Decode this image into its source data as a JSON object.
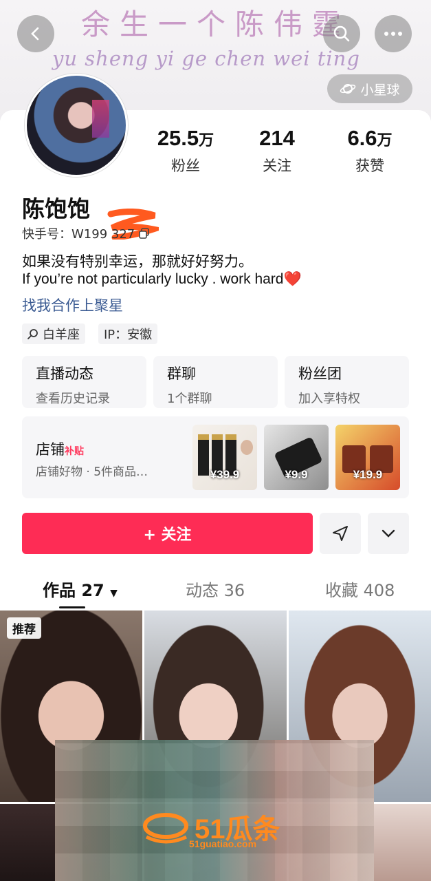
{
  "banner": {
    "title": "余生一个陈伟霆",
    "subtitle": "yu sheng yi ge chen wei ting"
  },
  "header": {
    "back_icon": "chevron-left-icon",
    "search_icon": "search-icon",
    "more_icon": "more-icon",
    "planet_label": "小星球"
  },
  "profile": {
    "stats": [
      {
        "value": "25.5",
        "unit": "万",
        "label": "粉丝"
      },
      {
        "value": "214",
        "unit": "",
        "label": "关注"
      },
      {
        "value": "6.6",
        "unit": "万",
        "label": "获赞"
      }
    ],
    "name": "陈饱饱",
    "kuaishou_id": "快手号：W199  327",
    "bio_line1": "如果没有特别幸运，那就好好努力。",
    "bio_line2": "If you’re not particularly lucky . work hard",
    "bio_emoji": "❤️",
    "cooperate_link": "找我合作上聚星",
    "tags": [
      "白羊座",
      "IP：安徽"
    ]
  },
  "features": [
    {
      "title": "直播动态",
      "subtitle": "查看历史记录"
    },
    {
      "title": "群聊",
      "subtitle": "1个群聊"
    },
    {
      "title": "粉丝团",
      "subtitle": "加入享特权"
    }
  ],
  "shop": {
    "title": "店铺",
    "badge": "补贴",
    "subtitle": "店铺好物 · 5件商品…",
    "items": [
      {
        "price": "¥39.9"
      },
      {
        "price": "¥9.9"
      },
      {
        "price": "¥19.9"
      }
    ]
  },
  "actions": {
    "follow_label": "+ 关注",
    "share_icon": "send-icon",
    "dropdown_icon": "chevron-down-icon"
  },
  "tabs": [
    {
      "label": "作品 27",
      "active": true
    },
    {
      "label": "动态 36",
      "active": false
    },
    {
      "label": "收藏 408",
      "active": false
    }
  ],
  "grid": {
    "pinned_label": "推荐"
  },
  "watermark": {
    "brand": "51瓜条",
    "url": "51guatiao.com"
  },
  "colors": {
    "accent": "#fe2c55",
    "link": "#3a5a92"
  }
}
